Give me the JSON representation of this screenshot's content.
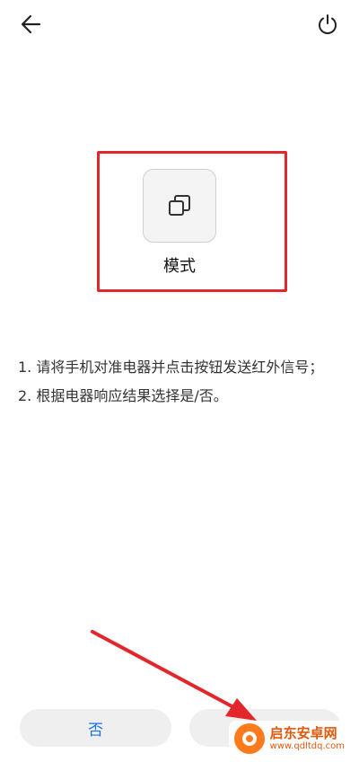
{
  "header": {
    "back_icon": "arrow-left-icon",
    "power_icon": "power-icon"
  },
  "mode_key": {
    "icon": "copy-mode-icon",
    "label": "模式",
    "highlight_color": "#e3262b"
  },
  "instructions": {
    "line1": "1. 请将手机对准电器并点击按钮发送红外信号；",
    "line2": "2. 根据电器响应结果选择是/否。"
  },
  "buttons": {
    "no_label": "否",
    "yes_label": "",
    "accent": "#1a73e8"
  },
  "watermark": {
    "title": "启东安卓网",
    "url": "www.qdltdq.com"
  }
}
